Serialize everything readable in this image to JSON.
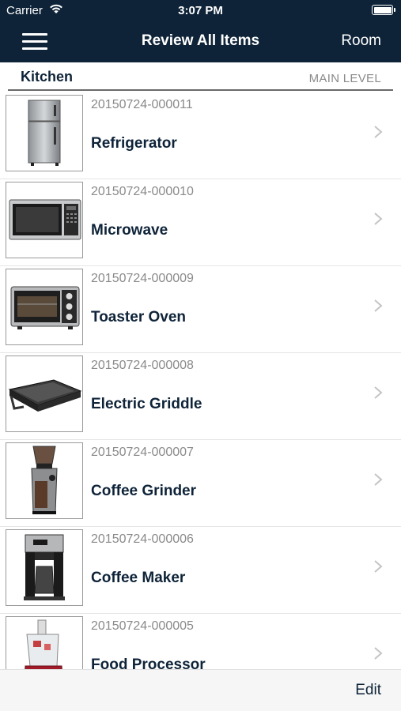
{
  "status_bar": {
    "carrier": "Carrier",
    "time": "3:07 PM"
  },
  "nav": {
    "title": "Review All Items",
    "right_label": "Room"
  },
  "section": {
    "room": "Kitchen",
    "level": "MAIN LEVEL"
  },
  "items": [
    {
      "id": "20150724-000011",
      "name": "Refrigerator",
      "icon": "refrigerator-icon"
    },
    {
      "id": "20150724-000010",
      "name": "Microwave",
      "icon": "microwave-icon"
    },
    {
      "id": "20150724-000009",
      "name": "Toaster Oven",
      "icon": "toaster-oven-icon"
    },
    {
      "id": "20150724-000008",
      "name": "Electric Griddle",
      "icon": "griddle-icon"
    },
    {
      "id": "20150724-000007",
      "name": "Coffee Grinder",
      "icon": "coffee-grinder-icon"
    },
    {
      "id": "20150724-000006",
      "name": "Coffee Maker",
      "icon": "coffee-maker-icon"
    },
    {
      "id": "20150724-000005",
      "name": "Food Processor",
      "icon": "food-processor-icon"
    }
  ],
  "toolbar": {
    "edit_label": "Edit"
  },
  "colors": {
    "nav_background": "#0e2338",
    "item_title": "#0e2338",
    "item_id": "#8a8a8a"
  }
}
